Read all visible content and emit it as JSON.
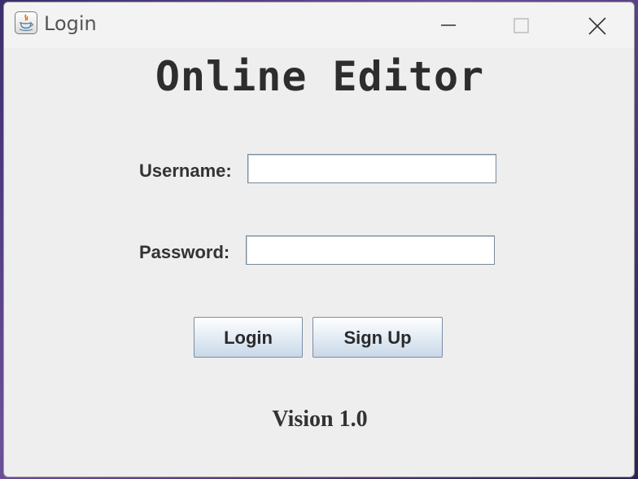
{
  "window": {
    "title": "Login",
    "app_icon": "java-coffee-icon",
    "controls": [
      "minimize-icon",
      "maximize-icon",
      "close-icon"
    ]
  },
  "main": {
    "heading": "Online Editor",
    "username_label": "Username:",
    "username_value": "",
    "password_label": "Password:",
    "password_value": "",
    "login_button": "Login",
    "signup_button": "Sign Up",
    "version": "Vision 1.0"
  },
  "colors": {
    "window_bg": "#eeeeee",
    "titlebar_bg": "#f3f3f3",
    "text": "#333333",
    "button_gradient_top": "#ffffff",
    "button_gradient_bottom": "#c9d8e7"
  }
}
